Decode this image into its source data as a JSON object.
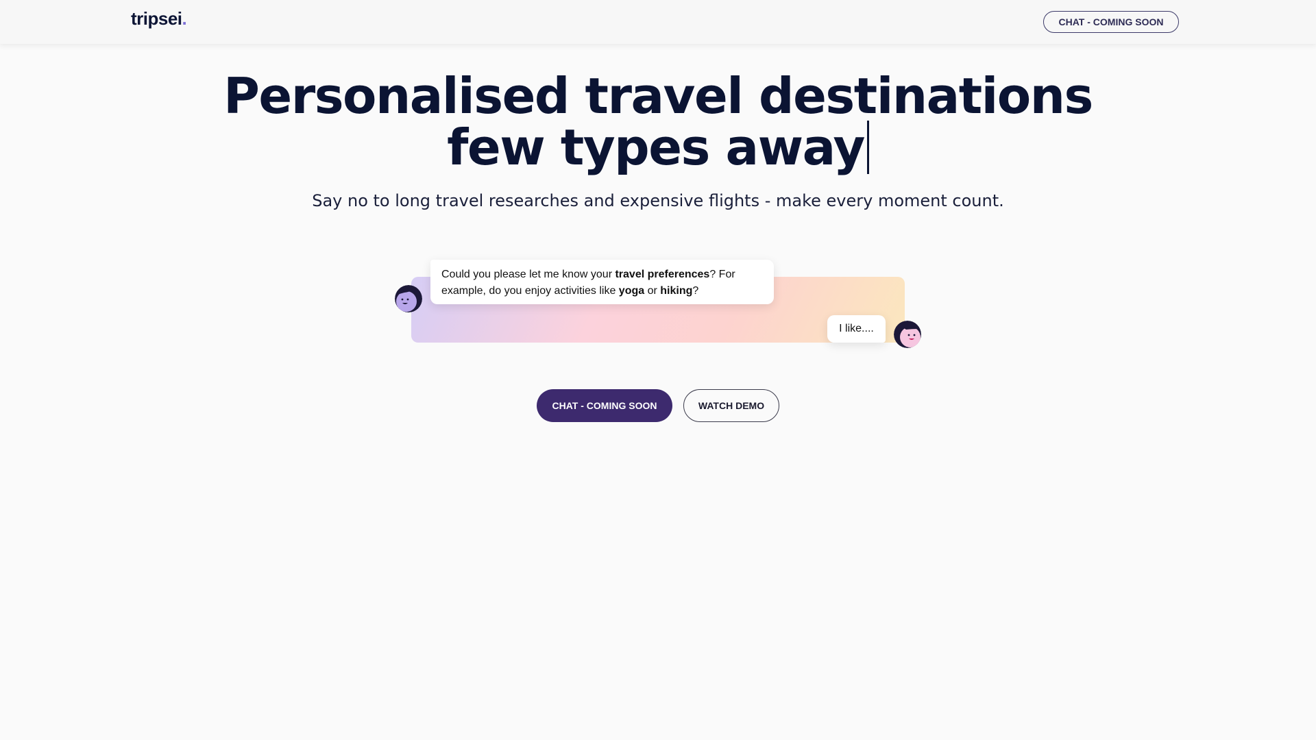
{
  "header": {
    "logo_text": "tripsei",
    "logo_dot": ".",
    "cta_label": "CHAT - COMING SOON"
  },
  "hero": {
    "title_line1": "Personalised travel destinations",
    "title_line2": "few types away",
    "subtitle": "Say no to long travel researches and expensive flights - make every moment count."
  },
  "chat": {
    "bot_message": {
      "part1": "Could you please let me know your ",
      "bold1": "travel preferences",
      "part2": "? For example, do you enjoy activities like ",
      "bold2": "yoga",
      "part3": " or ",
      "bold3": "hiking",
      "part4": "?"
    },
    "user_message": "I like....",
    "bot_avatar_icon": "bot-face-icon",
    "user_avatar_icon": "user-face-icon"
  },
  "actions": {
    "primary_label": "CHAT - COMING SOON",
    "secondary_label": "WATCH DEMO"
  },
  "colors": {
    "brand_dark": "#0b1433",
    "primary_button": "#3d2a6e",
    "logo_dot": "#7c6fd6",
    "background": "#fafafa"
  }
}
